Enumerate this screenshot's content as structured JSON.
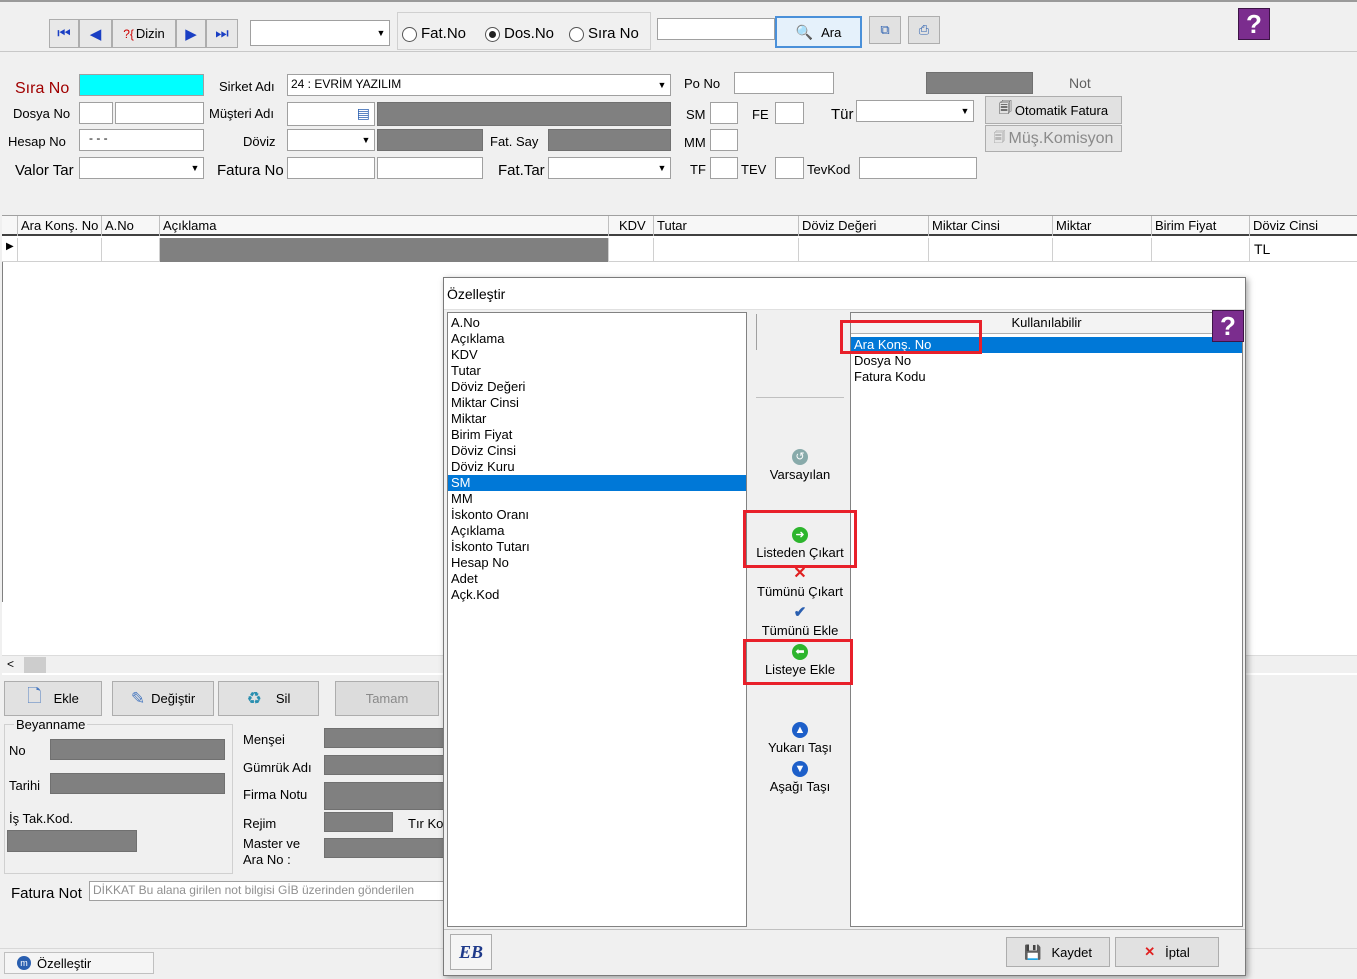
{
  "toolbar": {
    "dizin_label": "Dizin",
    "dizin_prefix": "?{",
    "radio_fatno": "Fat.No",
    "radio_dosno": "Dos.No",
    "radio_sirano": "Sıra No",
    "search_label": "Ara"
  },
  "form": {
    "sira_no": "Sıra No",
    "sirket_adi": "Sirket Adı",
    "sirket_value": "24 : EVRİM YAZILIM",
    "po_no": "Po No",
    "not": "Not",
    "dosya_no": "Dosya No",
    "musteri_adi": "Müşteri Adı",
    "sm": "SM",
    "fe": "FE",
    "tur": "Tür",
    "otomatik_fatura": "Otomatik Fatura",
    "hesap_no": "Hesap No",
    "hesap_value": "- - -",
    "doviz": "Döviz",
    "fat_say": "Fat. Say",
    "mm": "MM",
    "mus_komisyon": "Müş.Komisyon",
    "valor_tar": "Valor Tar",
    "fatura_no": "Fatura No",
    "fat_tar": "Fat.Tar",
    "tf": "TF",
    "tev": "TEV",
    "tevkod": "TevKod"
  },
  "grid": {
    "columns": [
      "Ara Konş. No",
      "A.No",
      "Açıklama",
      "KDV",
      "Tutar",
      "Döviz Değeri",
      "Miktar Cinsi",
      "Miktar",
      "Birim Fiyat",
      "Döviz Cinsi"
    ],
    "row_doviz": "TL"
  },
  "actions": {
    "ekle": "Ekle",
    "degistir": "Değiştir",
    "sil": "Sil",
    "tamam": "Tamam"
  },
  "beyanname": {
    "title": "Beyanname",
    "no": "No",
    "tarihi": "Tarihi",
    "is_tak_kod": "İş Tak.Kod.",
    "mensei": "Menşei",
    "gumruk_adi": "Gümrük Adı",
    "firma_notu": "Firma Notu",
    "rejim": "Rejim",
    "tir_ko": "Tır Ko",
    "master_ve": "Master ve",
    "ara_no": "Ara No :"
  },
  "fatura_not": {
    "label": "Fatura Not",
    "placeholder": "DİKKAT Bu alana girilen not bilgisi GİB üzerinden gönderilen"
  },
  "taskbar": {
    "label": "Özelleştir"
  },
  "dialog": {
    "title": "Özelleştir",
    "left_items": [
      "A.No",
      "Açıklama",
      "KDV",
      "Tutar",
      "Döviz Değeri",
      "Miktar Cinsi",
      "Miktar",
      "Birim Fiyat",
      "Döviz Cinsi",
      "Döviz Kuru",
      "SM",
      "MM",
      "İskonto Oranı",
      "Açıklama",
      "İskonto Tutarı",
      "Hesap No",
      "Adet",
      "Açk.Kod"
    ],
    "left_selected_index": 10,
    "right_header": "Kullanılabilir",
    "right_items": [
      "Ara Konş. No",
      "Dosya No",
      "Fatura Kodu"
    ],
    "right_selected_index": 0,
    "btn_varsayilan": "Varsayılan",
    "btn_listeden_cikart": "Listeden Çıkart",
    "btn_tumunu_cikart": "Tümünü Çıkart",
    "btn_tumunu_ekle": "Tümünü Ekle",
    "btn_listeye_ekle": "Listeye Ekle",
    "btn_yukari_tasi": "Yukarı Taşı",
    "btn_asagi_tasi": "Aşağı Taşı",
    "logo_text": "EB",
    "btn_kaydet": "Kaydet",
    "btn_iptal": "İptal"
  },
  "colors": {
    "highlight_field": "#00ffff",
    "selection": "#0078d7",
    "annotation": "#e8202a",
    "help_purple": "#7b2d8e"
  }
}
